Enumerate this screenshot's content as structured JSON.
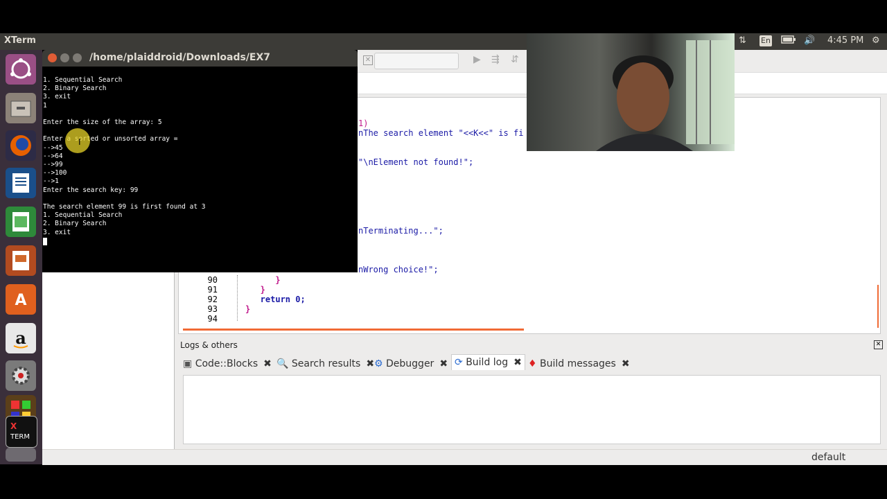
{
  "top_panel": {
    "app_name": "XTerm",
    "lang": "En",
    "clock": "4:45 PM"
  },
  "launcher": {
    "items": [
      "ubuntu-dash-icon",
      "files-icon",
      "firefox-icon",
      "writer-icon",
      "calc-icon",
      "impress-icon",
      "software-center-icon",
      "amazon-icon",
      "settings-icon",
      "codeblocks-icon",
      "xterm-icon",
      "trash-icon"
    ]
  },
  "xterm": {
    "title": "/home/plaiddroid/Downloads/EX7",
    "lines": [
      "1. Sequential Search",
      "2. Binary Search",
      "3. exit",
      "1",
      "",
      "Enter the size of the array: 5",
      "",
      "Enter a sorted or unsorted array =",
      "-->45",
      "-->64",
      "-->99",
      "-->100",
      "-->1",
      "Enter the search key: 99",
      "",
      "The search element 99 is first found at 3",
      "1. Sequential Search",
      "2. Binary Search",
      "3. exit"
    ]
  },
  "editor": {
    "visible_fragments": [
      {
        "text": "1)"
      },
      {
        "text": "nThe search element \"<<K<<\" is fi"
      },
      {
        "text": "\"\\nElement not found!\";"
      },
      {
        "text": "nTerminating...\";"
      },
      {
        "text": "nWrong choice!\";"
      }
    ],
    "lines": [
      {
        "num": "90",
        "code": "      }"
      },
      {
        "num": "91",
        "code": "   }"
      },
      {
        "num": "92",
        "code": "   return 0;"
      },
      {
        "num": "93",
        "code": "}"
      },
      {
        "num": "94",
        "code": ""
      }
    ]
  },
  "logs": {
    "header": "Logs & others",
    "tabs": [
      {
        "label": "Code::Blocks"
      },
      {
        "label": "Search results"
      },
      {
        "label": "Debugger"
      },
      {
        "label": "Build log",
        "active": true
      },
      {
        "label": "Build messages"
      }
    ]
  },
  "status": {
    "profile": "default"
  }
}
